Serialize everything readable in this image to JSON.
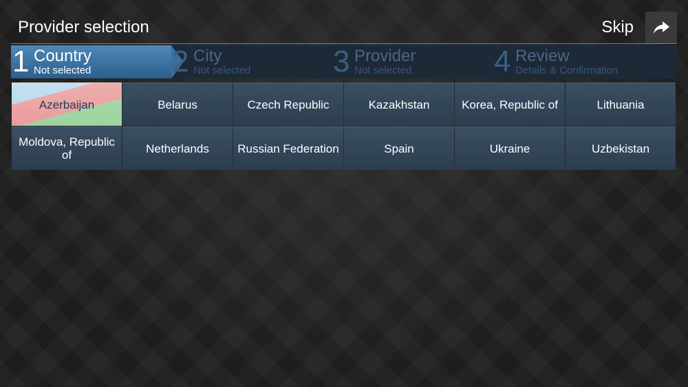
{
  "header": {
    "title": "Provider selection",
    "skip_label": "Skip"
  },
  "steps": [
    {
      "number": "1",
      "title": "Country",
      "subtitle": "Not selected",
      "active": true
    },
    {
      "number": "2",
      "title": "City",
      "subtitle": "Not selected",
      "active": false
    },
    {
      "number": "3",
      "title": "Provider",
      "subtitle": "Not selected",
      "active": false
    },
    {
      "number": "4",
      "title": "Review",
      "subtitle": "Details & Confirmation",
      "active": false
    }
  ],
  "countries": [
    "Azerbaijan",
    "Belarus",
    "Czech Republic",
    "Kazakhstan",
    "Korea, Republic of",
    "Lithuania",
    "Moldova, Republic of",
    "Netherlands",
    "Russian Federation",
    "Spain",
    "Ukraine",
    "Uzbekistan"
  ],
  "colors": {
    "accent": "#4d8fc6",
    "active_step": "#3a6f9f",
    "tile": "#34475a"
  },
  "icons": {
    "skip": "share-arrow-icon"
  }
}
